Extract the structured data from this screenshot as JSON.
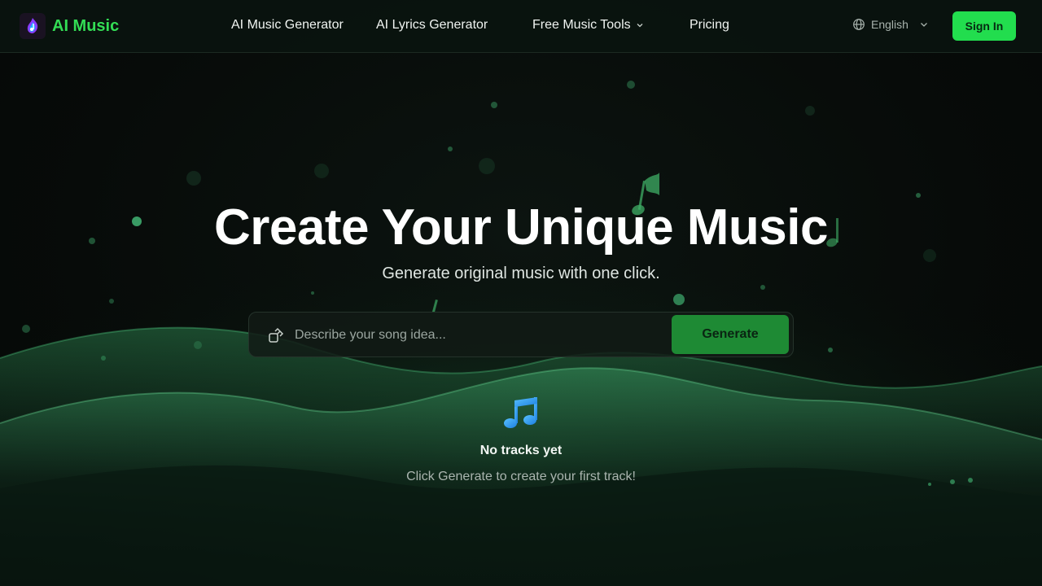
{
  "brand": {
    "name": "AI Music",
    "accent": "#33dd55"
  },
  "nav": {
    "items": [
      {
        "label": "AI Music Generator"
      },
      {
        "label": "AI Lyrics Generator"
      },
      {
        "label": "Free Music Tools"
      },
      {
        "label": "Pricing"
      }
    ]
  },
  "language": {
    "selected": "English"
  },
  "auth": {
    "signin_label": "Sign In"
  },
  "hero": {
    "title": "Create Your Unique Music",
    "subtitle": "Generate original music with one click."
  },
  "prompt": {
    "placeholder": "Describe your song idea...",
    "value": "",
    "generate_label": "Generate"
  },
  "tracks": {
    "empty_title": "No tracks yet",
    "empty_hint": "Click Generate to create your first track!"
  },
  "icons": {
    "logo": "music-flame-logo-icon",
    "language": "globe-icon",
    "dropdown": "chevron-down-icon",
    "prompt": "external-input-icon",
    "empty": "music-note-icon"
  },
  "colors": {
    "primary_button": "#22dd4e",
    "generate_button": "#1e8a34",
    "background": "#070b09"
  }
}
